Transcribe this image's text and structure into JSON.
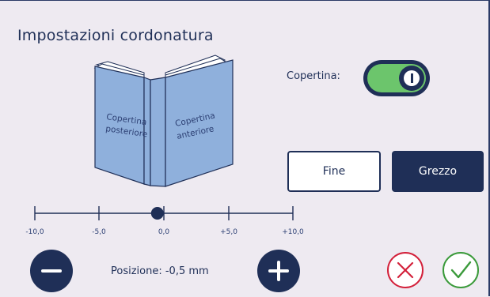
{
  "screen": {
    "title": "Impostazioni cordonatura"
  },
  "book": {
    "back_cover_line1": "Copertina",
    "back_cover_line2": "posteriore",
    "front_cover_line1": "Copertina",
    "front_cover_line2": "anteriore"
  },
  "cover": {
    "label": "Copertina:",
    "enabled": true
  },
  "mode": {
    "options": [
      "Fine",
      "Grezzo"
    ],
    "selected": "Grezzo"
  },
  "position": {
    "scale_labels": [
      "-10,0",
      "-5,0",
      "0,0",
      "+5,0",
      "+10,0"
    ],
    "current_value_mm": -0.5,
    "readout": "Posizione: -0,5 mm"
  },
  "colors": {
    "navy": "#1f2f57",
    "toggle_on": "#6cc56c",
    "cancel_red": "#d3203a",
    "confirm_green": "#3a9a3a",
    "book_blue": "#8fb0dc",
    "background": "#eeeaf1"
  },
  "icons": {
    "decrease": "minus-icon",
    "increase": "plus-icon",
    "cancel": "x-circle-icon",
    "confirm": "check-circle-icon"
  }
}
